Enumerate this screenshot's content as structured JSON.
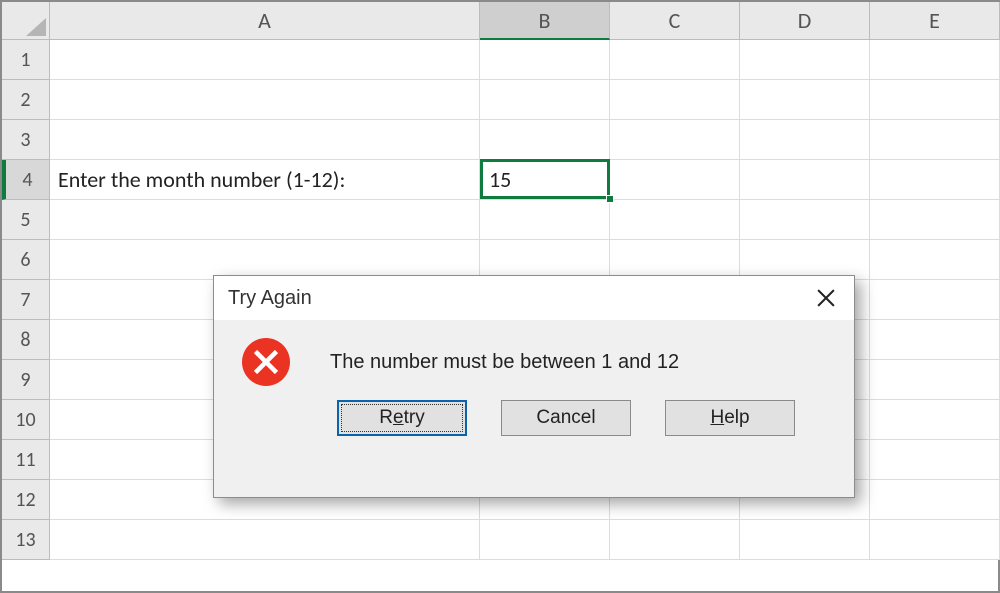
{
  "columns": [
    "A",
    "B",
    "C",
    "D",
    "E"
  ],
  "rows": [
    "1",
    "2",
    "3",
    "4",
    "5",
    "6",
    "7",
    "8",
    "9",
    "10",
    "11",
    "12",
    "13"
  ],
  "cells": {
    "A4": "Enter the month number (1-12):",
    "B4": "15"
  },
  "active": {
    "col": "B",
    "row": "4"
  },
  "dialog": {
    "title": "Try Again",
    "message": "The number must be between 1 and 12",
    "buttons": {
      "retry": {
        "pre": "R",
        "u": "e",
        "post": "try"
      },
      "cancel": "Cancel",
      "help": {
        "pre": "",
        "u": "H",
        "post": "elp"
      }
    }
  }
}
